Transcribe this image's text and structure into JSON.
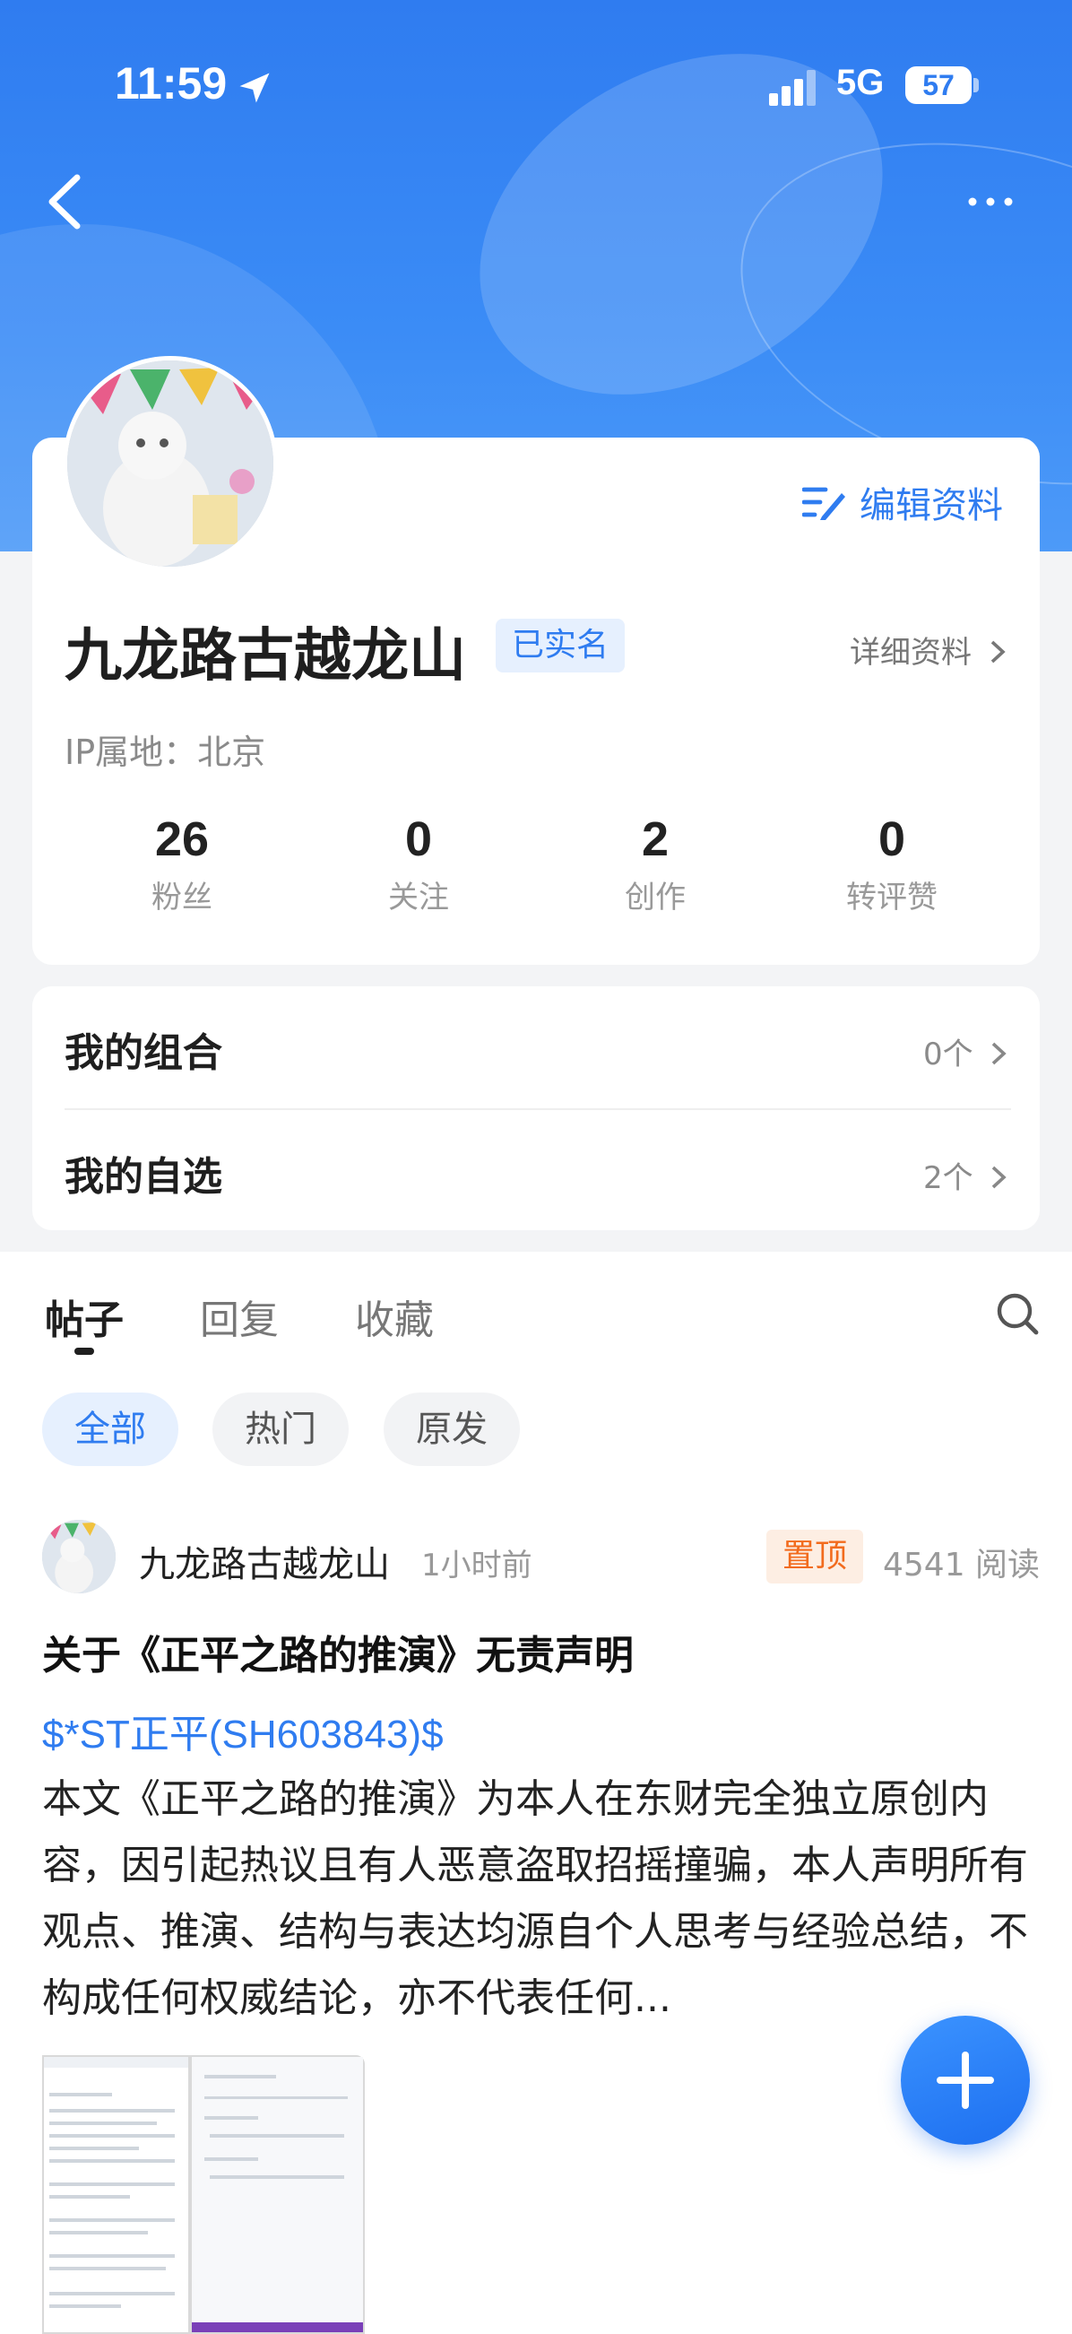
{
  "status_bar": {
    "time": "11:59",
    "network": "5G",
    "battery": "57"
  },
  "profile": {
    "edit_label": "编辑资料",
    "username": "九龙路古越龙山",
    "verified": "已实名",
    "detail_link": "详细资料",
    "ip_location": "IP属地：北京",
    "stats": [
      {
        "value": "26",
        "label": "粉丝"
      },
      {
        "value": "0",
        "label": "关注"
      },
      {
        "value": "2",
        "label": "创作"
      },
      {
        "value": "0",
        "label": "转评赞"
      }
    ]
  },
  "lists": {
    "portfolio_label": "我的组合",
    "portfolio_count": "0个",
    "watchlist_label": "我的自选",
    "watchlist_count": "2个"
  },
  "tabs": [
    "帖子",
    "回复",
    "收藏"
  ],
  "filters": [
    "全部",
    "热门",
    "原发"
  ],
  "post": {
    "author": "九龙路古越龙山",
    "time": "1小时前",
    "pinned": "置顶",
    "reads": "4541 阅读",
    "title": "关于《正平之路的推演》无责声明",
    "stock": "$*ST正平(SH603843)$",
    "body": " 本文《正平之路的推演》为本人在东财完全独立原创内容，因引起热议且有人恶意盗取招摇撞骗，本人声明所有观点、推演、结构与表达均源自个人思考与经验总结，不构成任何权威结论，亦不代表任何..."
  },
  "colors": {
    "accent": "#2f7cf0",
    "pin": "#f26b1d"
  },
  "icons": [
    "location-arrow-icon",
    "signal-icon",
    "back-icon",
    "more-icon",
    "edit-icon",
    "chevron-right-icon",
    "search-icon",
    "plus-icon"
  ]
}
